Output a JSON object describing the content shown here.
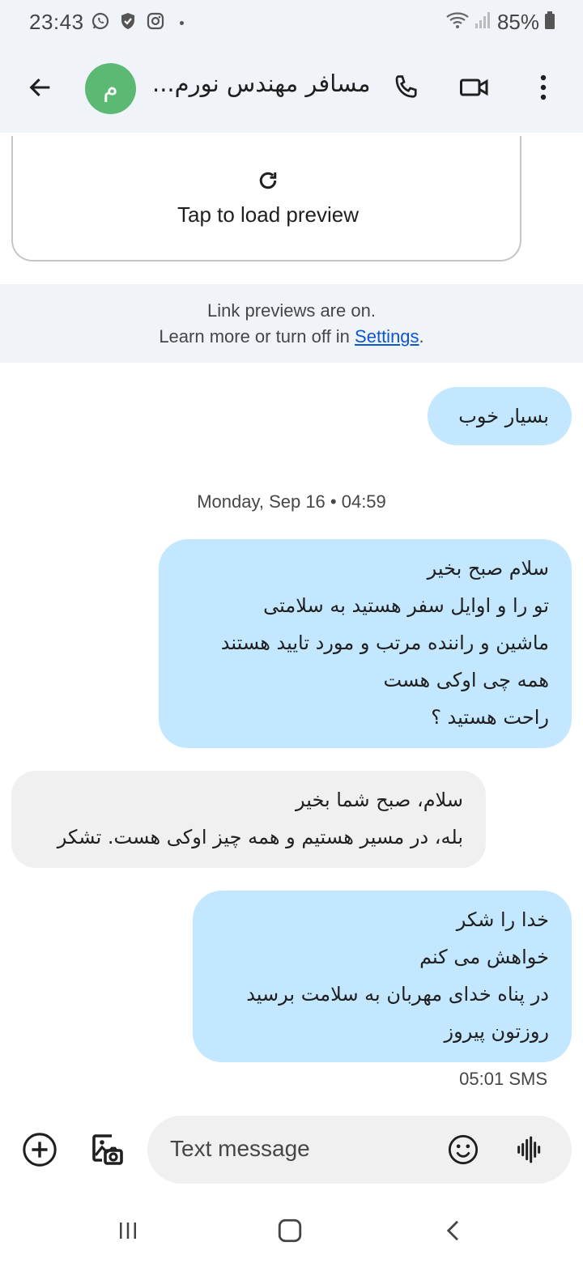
{
  "status_bar": {
    "time": "23:43",
    "battery": "85%",
    "notification_icons": [
      "whatsapp-icon",
      "shield-icon",
      "instagram-icon"
    ]
  },
  "header": {
    "avatar_letter": "م",
    "contact_name": "مسافر مهندس نورم...",
    "icons": [
      "back-arrow-icon",
      "phone-icon",
      "video-icon",
      "more-vert-icon"
    ]
  },
  "preview": {
    "label": "Tap to load preview"
  },
  "link_info": {
    "line1": "Link previews are on.",
    "line2_prefix": "Learn more or turn off in ",
    "link_text": "Settings",
    "line2_suffix": "."
  },
  "messages": [
    {
      "direction": "outgoing",
      "lines": [
        "بسیار خوب"
      ]
    },
    {
      "direction": "outgoing",
      "lines": [
        "سلام صبح بخیر",
        "تو را و اوایل سفر هستید به سلامتی",
        "ماشین و راننده مرتب و مورد تایید هستند",
        "همه چی اوکی هست",
        "راحت هستید ؟"
      ]
    },
    {
      "direction": "incoming",
      "lines": [
        "سلام، صبح شما بخیر",
        "بله، در مسیر هستیم و همه چیز اوکی هست. تشکر"
      ]
    },
    {
      "direction": "outgoing",
      "lines": [
        "خدا را شکر",
        "خواهش می کنم",
        "در پناه خدای مهربان به سلامت برسید",
        "روزتون پیروز"
      ]
    }
  ],
  "date_separator": "Monday, Sep 16 • 04:59",
  "last_meta": "05:01 SMS",
  "compose": {
    "placeholder": "Text message"
  },
  "colors": {
    "outgoing_bubble": "#c2e7ff",
    "incoming_bubble": "#f0f0f0",
    "avatar": "#5bb974",
    "link": "#0b57d0",
    "header_bg": "#f0f4f9"
  }
}
